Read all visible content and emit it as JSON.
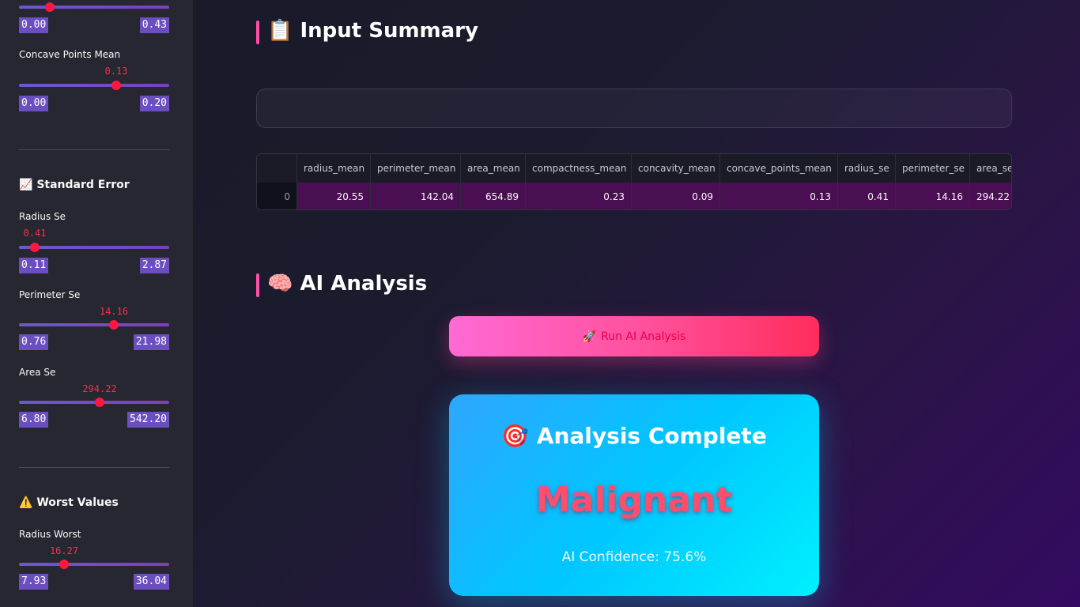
{
  "sidebar": {
    "sliders": [
      {
        "id": "compactness_mean",
        "label": "",
        "value": "",
        "min": "0.00",
        "max": "0.43",
        "fraction": 0.21
      },
      {
        "id": "concave_points_mean",
        "label": "Concave Points Mean",
        "value": "0.13",
        "min": "0.00",
        "max": "0.20",
        "fraction": 0.65
      },
      {
        "id": "radius_se",
        "label": "Radius Se",
        "value": "0.41",
        "min": "0.11",
        "max": "2.87",
        "fraction": 0.11
      },
      {
        "id": "perimeter_se",
        "label": "Perimeter Se",
        "value": "14.16",
        "min": "0.76",
        "max": "21.98",
        "fraction": 0.63
      },
      {
        "id": "area_se",
        "label": "Area Se",
        "value": "294.22",
        "min": "6.80",
        "max": "542.20",
        "fraction": 0.54
      },
      {
        "id": "radius_worst",
        "label": "Radius Worst",
        "value": "16.27",
        "min": "7.93",
        "max": "36.04",
        "fraction": 0.3
      }
    ],
    "sections": {
      "standard_error": {
        "icon": "📈",
        "title": "Standard Error"
      },
      "worst_values": {
        "icon": "⚠️",
        "title": "Worst Values"
      }
    }
  },
  "main": {
    "input_summary": {
      "icon": "📋",
      "title": "Input Summary"
    },
    "ai_analysis": {
      "icon": "🧠",
      "title": "AI Analysis"
    },
    "table": {
      "columns": [
        "",
        "radius_mean",
        "perimeter_mean",
        "area_mean",
        "compactness_mean",
        "concavity_mean",
        "concave_points_mean",
        "radius_se",
        "perimeter_se",
        "area_se"
      ],
      "rows": [
        [
          "0",
          "20.55",
          "142.04",
          "654.89",
          "0.23",
          "0.09",
          "0.13",
          "0.41",
          "14.16",
          "294.22"
        ]
      ]
    },
    "run_button": {
      "icon": "🚀",
      "label": "Run AI Analysis"
    },
    "result": {
      "icon": "🎯",
      "title": "Analysis Complete",
      "diagnosis": "Malignant",
      "confidence": "AI Confidence: 75.6%"
    }
  },
  "colors": {
    "sidebar_bg": "#262730",
    "accent_red": "#ff1744",
    "range_badge": "#6b4fc0",
    "button_gradient": [
      "#ff6ad5",
      "#ff2d5c"
    ],
    "card_gradient": [
      "#2fa6ff",
      "#00f0ff"
    ],
    "diagnosis_color": "#ff4d6d"
  }
}
